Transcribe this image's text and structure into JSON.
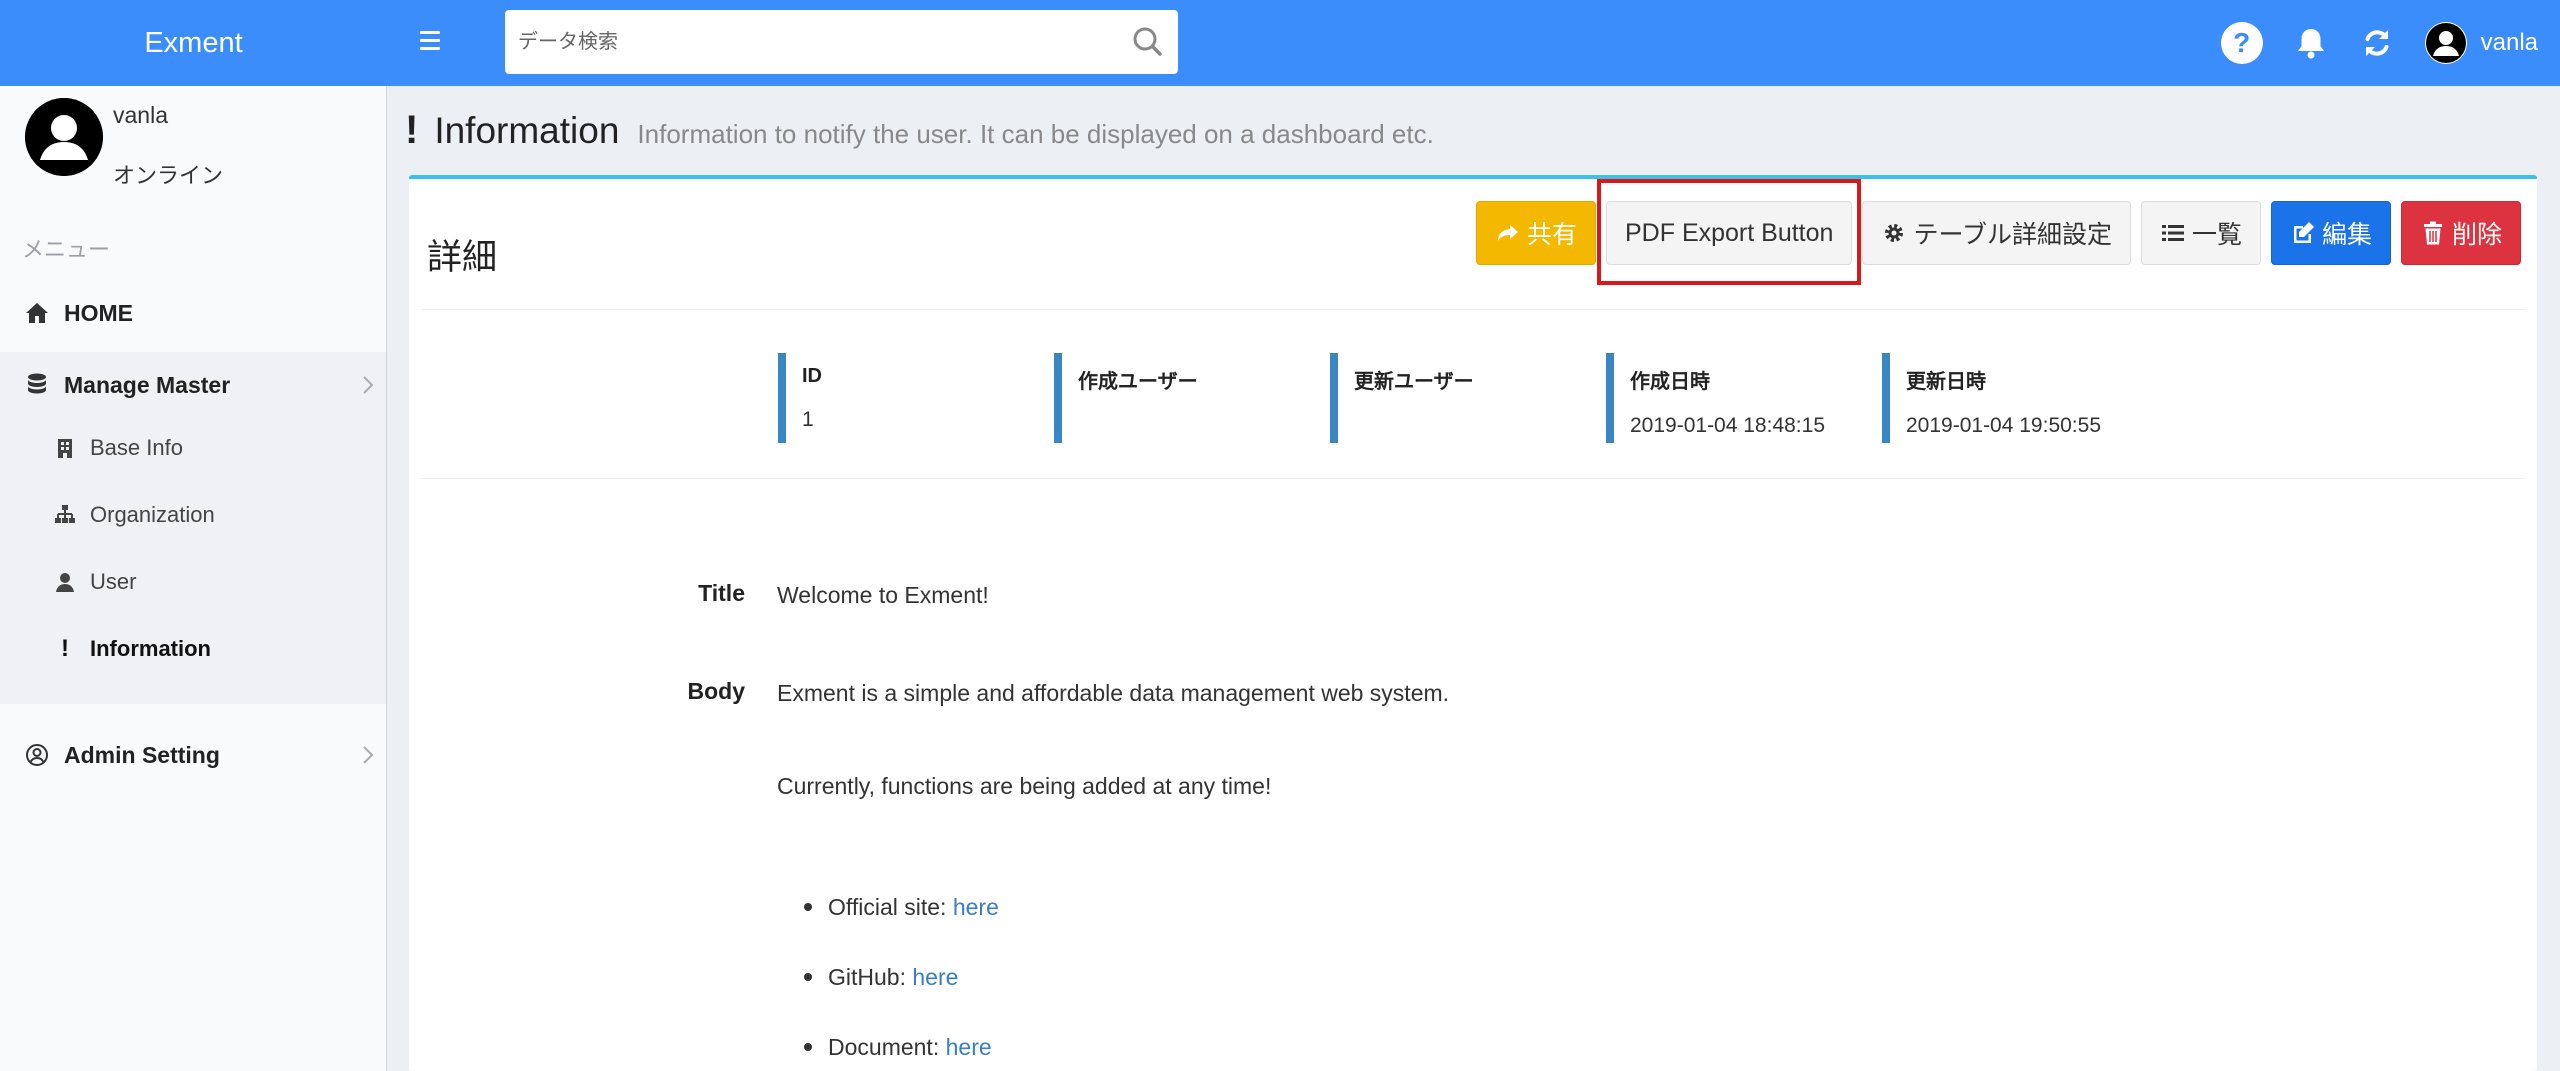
{
  "app": {
    "brand": "Exment"
  },
  "topbar": {
    "search_placeholder": "データ検索",
    "user_name": "vanla"
  },
  "sidebar": {
    "user_name": "vanla",
    "user_status": "オンライン",
    "menu_header": "メニュー",
    "items": {
      "home": "HOME",
      "manage_master": "Manage Master",
      "base_info": "Base Info",
      "organization": "Organization",
      "user": "User",
      "information": "Information",
      "admin_setting": "Admin Setting"
    }
  },
  "header": {
    "icon_glyph": "!",
    "title": "Information",
    "subtitle": "Information to notify the user. It can be displayed on a dashboard etc."
  },
  "box": {
    "title": "詳細",
    "buttons": {
      "share": "共有",
      "pdf_export": "PDF Export Button",
      "table_settings": "テーブル詳細設定",
      "list": "一覧",
      "edit": "編集",
      "delete": "削除"
    },
    "meta": [
      {
        "label": "ID",
        "value": "1"
      },
      {
        "label": "作成ユーザー",
        "value": ""
      },
      {
        "label": "更新ユーザー",
        "value": ""
      },
      {
        "label": "作成日時",
        "value": "2019-01-04 18:48:15"
      },
      {
        "label": "更新日時",
        "value": "2019-01-04 19:50:55"
      }
    ],
    "fields": {
      "title_label": "Title",
      "title_value": "Welcome to Exment!",
      "body_label": "Body",
      "body_line1": "Exment is a simple and affordable data management web system.",
      "body_line2": "Currently, functions are being added at any time!",
      "links": [
        {
          "label": "Official site: ",
          "link_text": "here"
        },
        {
          "label": "GitHub: ",
          "link_text": "here"
        },
        {
          "label": "Document: ",
          "link_text": "here"
        }
      ]
    }
  },
  "colors": {
    "topbar": "#3c8dfc",
    "box_accent": "#3cc0e8",
    "meta_bar": "#3a86c2",
    "share_btn": "#f5b800",
    "edit_btn": "#1a73e8",
    "delete_btn": "#dd3341",
    "highlight": "#d7191c"
  }
}
